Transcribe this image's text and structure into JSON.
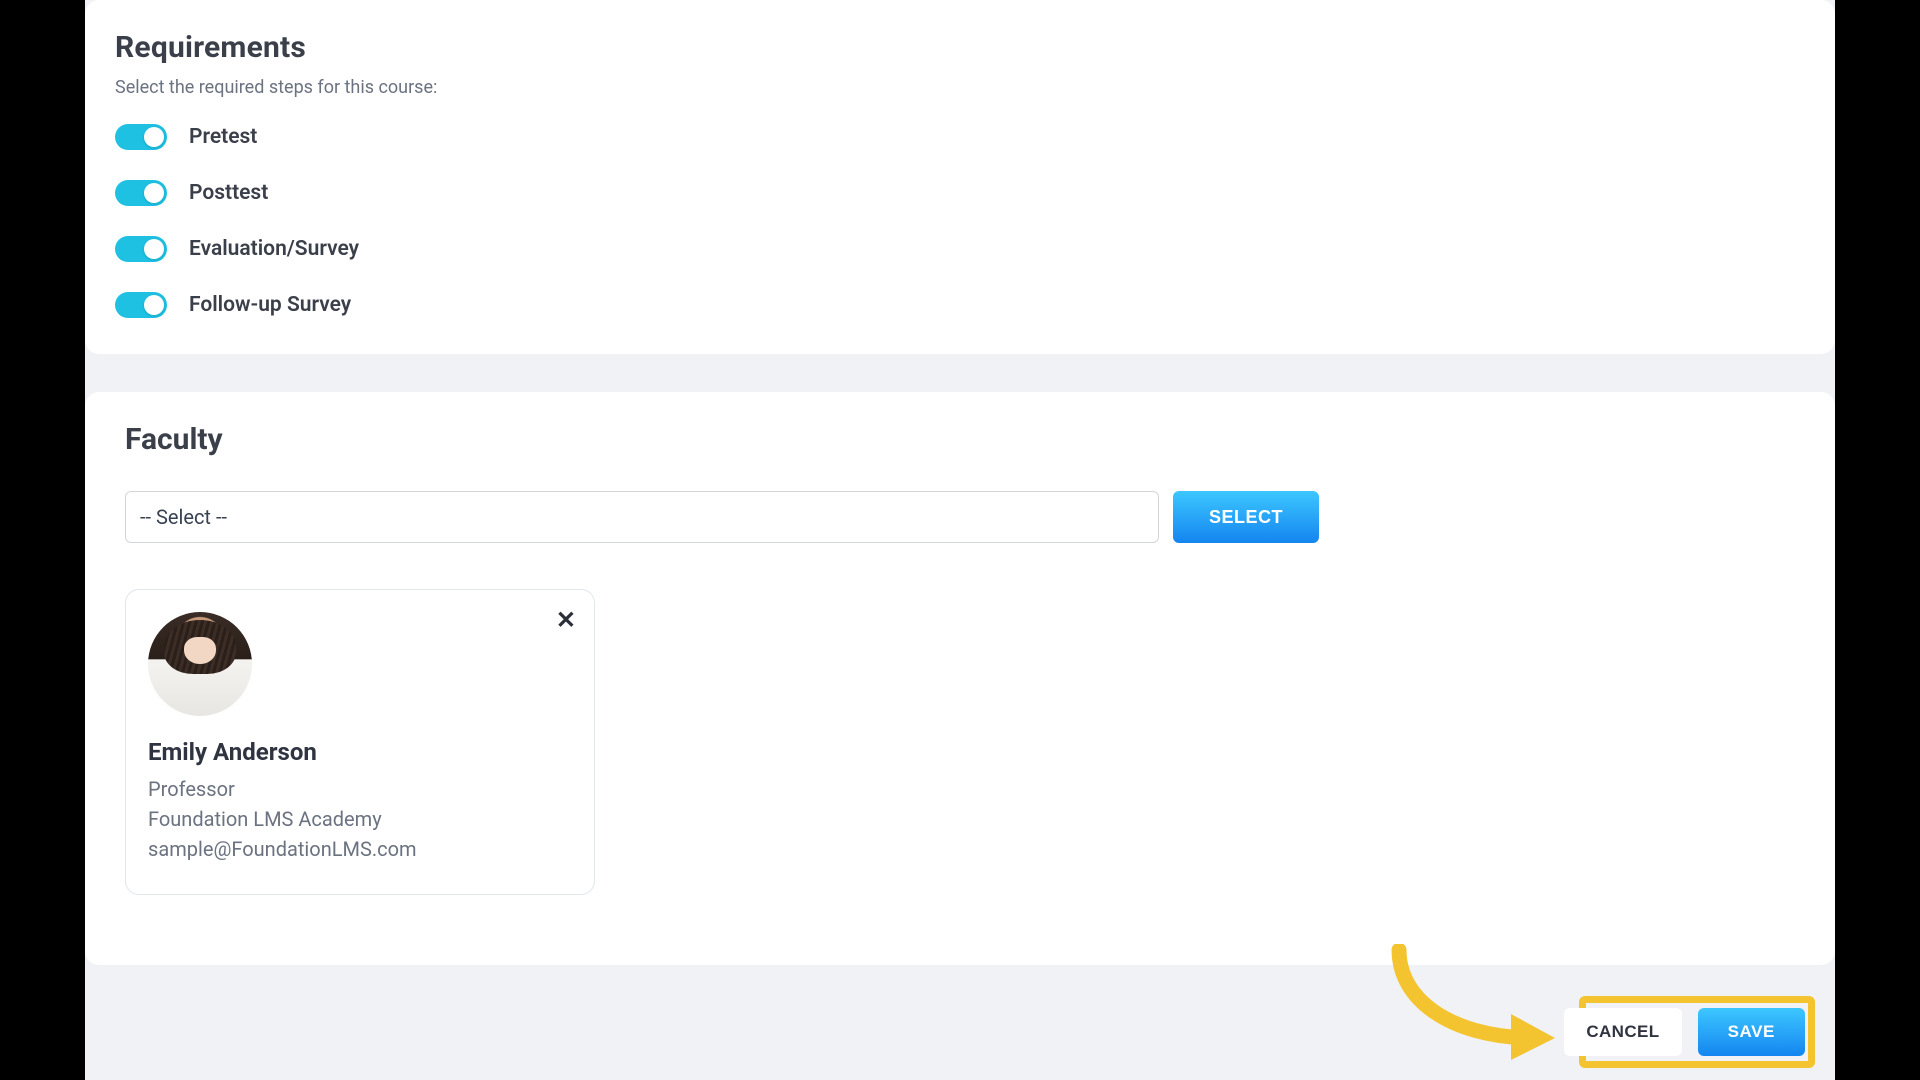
{
  "requirements": {
    "title": "Requirements",
    "subtitle": "Select the required steps for this course:",
    "items": [
      {
        "label": "Pretest",
        "on": true
      },
      {
        "label": "Posttest",
        "on": true
      },
      {
        "label": "Evaluation/Survey",
        "on": true
      },
      {
        "label": "Follow-up Survey",
        "on": true
      }
    ]
  },
  "faculty": {
    "title": "Faculty",
    "select_placeholder": "-- Select --",
    "select_btn": "SELECT",
    "person": {
      "name": "Emily Anderson",
      "role": "Professor",
      "org": "Foundation LMS Academy",
      "email": "sample@FoundationLMS.com"
    }
  },
  "actions": {
    "cancel": "CANCEL",
    "save": "SAVE"
  }
}
